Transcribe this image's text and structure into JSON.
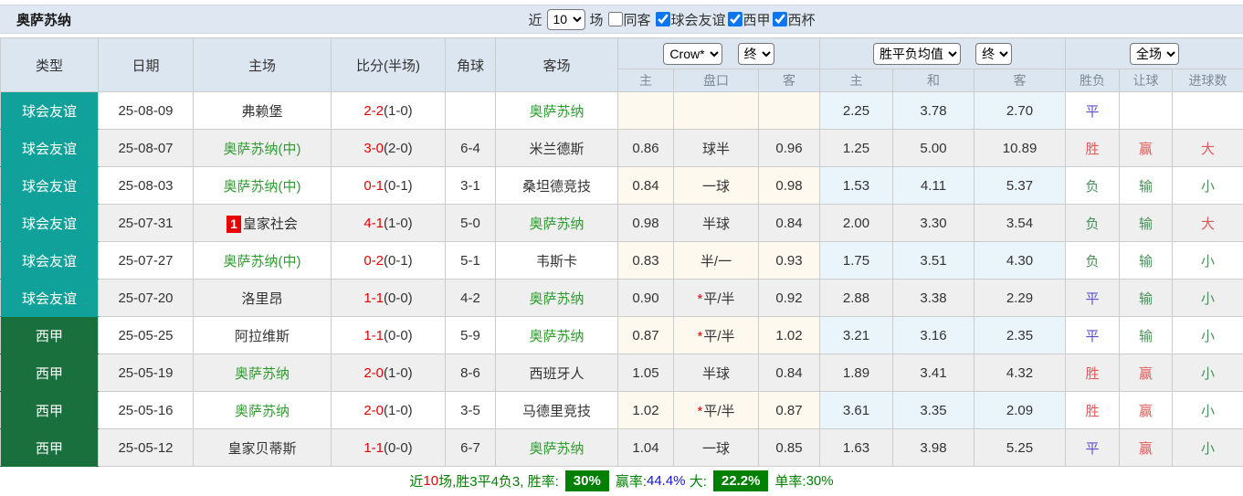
{
  "topbar": {
    "title": "奥萨苏纳",
    "near_label": "近",
    "count_value": "10",
    "unit_label": "场",
    "same_away": {
      "label": "同客",
      "checked": false
    },
    "filters": [
      {
        "label": "球会友谊",
        "checked": true
      },
      {
        "label": "西甲",
        "checked": true
      },
      {
        "label": "西杯",
        "checked": true
      }
    ]
  },
  "table": {
    "headers": {
      "type": "类型",
      "date": "日期",
      "home": "主场",
      "score": "比分(半场)",
      "corner": "角球",
      "away": "客场",
      "odds_source": "Crow*",
      "odds_time": "终",
      "odds_cols": [
        "主",
        "盘口",
        "客"
      ],
      "avg_source": "胜平负均值",
      "avg_time": "终",
      "avg_cols": [
        "主",
        "和",
        "客"
      ],
      "scope": "全场",
      "result_cols": [
        "胜负",
        "让球",
        "进球数"
      ]
    },
    "rows": [
      {
        "league": "球会友谊",
        "league_color": "teal",
        "date": "25-08-09",
        "home": "弗赖堡",
        "home_green": false,
        "home_badge": "",
        "score": "2-2",
        "half": "(1-0)",
        "corner": "",
        "away": "奥萨苏纳",
        "away_green": true,
        "odds_home": "",
        "handicap": "",
        "handicap_star": false,
        "odds_away": "",
        "avg_home": "2.25",
        "avg_draw": "3.78",
        "avg_away": "2.70",
        "result": "平",
        "result_color": "blue",
        "handicap_result": "",
        "handicap_result_color": "",
        "goals": "",
        "goals_color": ""
      },
      {
        "league": "球会友谊",
        "league_color": "teal",
        "date": "25-08-07",
        "home": "奥萨苏纳(中)",
        "home_green": true,
        "home_badge": "",
        "score": "3-0",
        "half": "(2-0)",
        "corner": "6-4",
        "away": "米兰德斯",
        "away_green": false,
        "odds_home": "0.86",
        "handicap": "球半",
        "handicap_star": false,
        "odds_away": "0.96",
        "avg_home": "1.25",
        "avg_draw": "5.00",
        "avg_away": "10.89",
        "result": "胜",
        "result_color": "red",
        "handicap_result": "赢",
        "handicap_result_color": "red",
        "goals": "大",
        "goals_color": "red"
      },
      {
        "league": "球会友谊",
        "league_color": "teal",
        "date": "25-08-03",
        "home": "奥萨苏纳(中)",
        "home_green": true,
        "home_badge": "",
        "score": "0-1",
        "half": "(0-1)",
        "corner": "3-1",
        "away": "桑坦德竞技",
        "away_green": false,
        "odds_home": "0.84",
        "handicap": "一球",
        "handicap_star": false,
        "odds_away": "0.98",
        "avg_home": "1.53",
        "avg_draw": "4.11",
        "avg_away": "5.37",
        "result": "负",
        "result_color": "green",
        "handicap_result": "输",
        "handicap_result_color": "green",
        "goals": "小",
        "goals_color": "green"
      },
      {
        "league": "球会友谊",
        "league_color": "teal",
        "date": "25-07-31",
        "home": "皇家社会",
        "home_green": false,
        "home_badge": "1",
        "score": "4-1",
        "half": "(1-0)",
        "corner": "5-0",
        "away": "奥萨苏纳",
        "away_green": true,
        "odds_home": "0.98",
        "handicap": "半球",
        "handicap_star": false,
        "odds_away": "0.84",
        "avg_home": "2.00",
        "avg_draw": "3.30",
        "avg_away": "3.54",
        "result": "负",
        "result_color": "green",
        "handicap_result": "输",
        "handicap_result_color": "green",
        "goals": "大",
        "goals_color": "red"
      },
      {
        "league": "球会友谊",
        "league_color": "teal",
        "date": "25-07-27",
        "home": "奥萨苏纳(中)",
        "home_green": true,
        "home_badge": "",
        "score": "0-2",
        "half": "(0-1)",
        "corner": "5-1",
        "away": "韦斯卡",
        "away_green": false,
        "odds_home": "0.83",
        "handicap": "半/一",
        "handicap_star": false,
        "odds_away": "0.93",
        "avg_home": "1.75",
        "avg_draw": "3.51",
        "avg_away": "4.30",
        "result": "负",
        "result_color": "green",
        "handicap_result": "输",
        "handicap_result_color": "green",
        "goals": "小",
        "goals_color": "green"
      },
      {
        "league": "球会友谊",
        "league_color": "teal",
        "date": "25-07-20",
        "home": "洛里昂",
        "home_green": false,
        "home_badge": "",
        "score": "1-1",
        "half": "(0-0)",
        "corner": "4-2",
        "away": "奥萨苏纳",
        "away_green": true,
        "odds_home": "0.90",
        "handicap": "平/半",
        "handicap_star": true,
        "odds_away": "0.92",
        "avg_home": "2.88",
        "avg_draw": "3.38",
        "avg_away": "2.29",
        "result": "平",
        "result_color": "blue",
        "handicap_result": "输",
        "handicap_result_color": "green",
        "goals": "小",
        "goals_color": "green"
      },
      {
        "league": "西甲",
        "league_color": "dark-green",
        "date": "25-05-25",
        "home": "阿拉维斯",
        "home_green": false,
        "home_badge": "",
        "score": "1-1",
        "half": "(0-0)",
        "corner": "5-9",
        "away": "奥萨苏纳",
        "away_green": true,
        "odds_home": "0.87",
        "handicap": "平/半",
        "handicap_star": true,
        "odds_away": "1.02",
        "avg_home": "3.21",
        "avg_draw": "3.16",
        "avg_away": "2.35",
        "result": "平",
        "result_color": "blue",
        "handicap_result": "输",
        "handicap_result_color": "green",
        "goals": "小",
        "goals_color": "green"
      },
      {
        "league": "西甲",
        "league_color": "dark-green",
        "date": "25-05-19",
        "home": "奥萨苏纳",
        "home_green": true,
        "home_badge": "",
        "score": "2-0",
        "half": "(1-0)",
        "corner": "8-6",
        "away": "西班牙人",
        "away_green": false,
        "odds_home": "1.05",
        "handicap": "半球",
        "handicap_star": false,
        "odds_away": "0.84",
        "avg_home": "1.89",
        "avg_draw": "3.41",
        "avg_away": "4.32",
        "result": "胜",
        "result_color": "red",
        "handicap_result": "赢",
        "handicap_result_color": "red",
        "goals": "小",
        "goals_color": "green"
      },
      {
        "league": "西甲",
        "league_color": "dark-green",
        "date": "25-05-16",
        "home": "奥萨苏纳",
        "home_green": true,
        "home_badge": "",
        "score": "2-0",
        "half": "(1-0)",
        "corner": "3-5",
        "away": "马德里竞技",
        "away_green": false,
        "odds_home": "1.02",
        "handicap": "平/半",
        "handicap_star": true,
        "odds_away": "0.87",
        "avg_home": "3.61",
        "avg_draw": "3.35",
        "avg_away": "2.09",
        "result": "胜",
        "result_color": "red",
        "handicap_result": "赢",
        "handicap_result_color": "red",
        "goals": "小",
        "goals_color": "green"
      },
      {
        "league": "西甲",
        "league_color": "dark-green",
        "date": "25-05-12",
        "home": "皇家贝蒂斯",
        "home_green": false,
        "home_badge": "",
        "score": "1-1",
        "half": "(0-0)",
        "corner": "6-7",
        "away": "奥萨苏纳",
        "away_green": true,
        "odds_home": "1.04",
        "handicap": "一球",
        "handicap_star": false,
        "odds_away": "0.85",
        "avg_home": "1.63",
        "avg_draw": "3.98",
        "avg_away": "5.25",
        "result": "平",
        "result_color": "blue",
        "handicap_result": "赢",
        "handicap_result_color": "red",
        "goals": "小",
        "goals_color": "green"
      }
    ]
  },
  "footer": {
    "prefix": "近",
    "count": "10",
    "mid": "场,胜3平4负3, 胜率:",
    "win_rate": "30%",
    "win_label": "赢率:",
    "win_pct": "44.4%",
    "big_label": "大:",
    "big_pct": "22.2%",
    "single_label": "单率:",
    "single_pct": "30%"
  }
}
